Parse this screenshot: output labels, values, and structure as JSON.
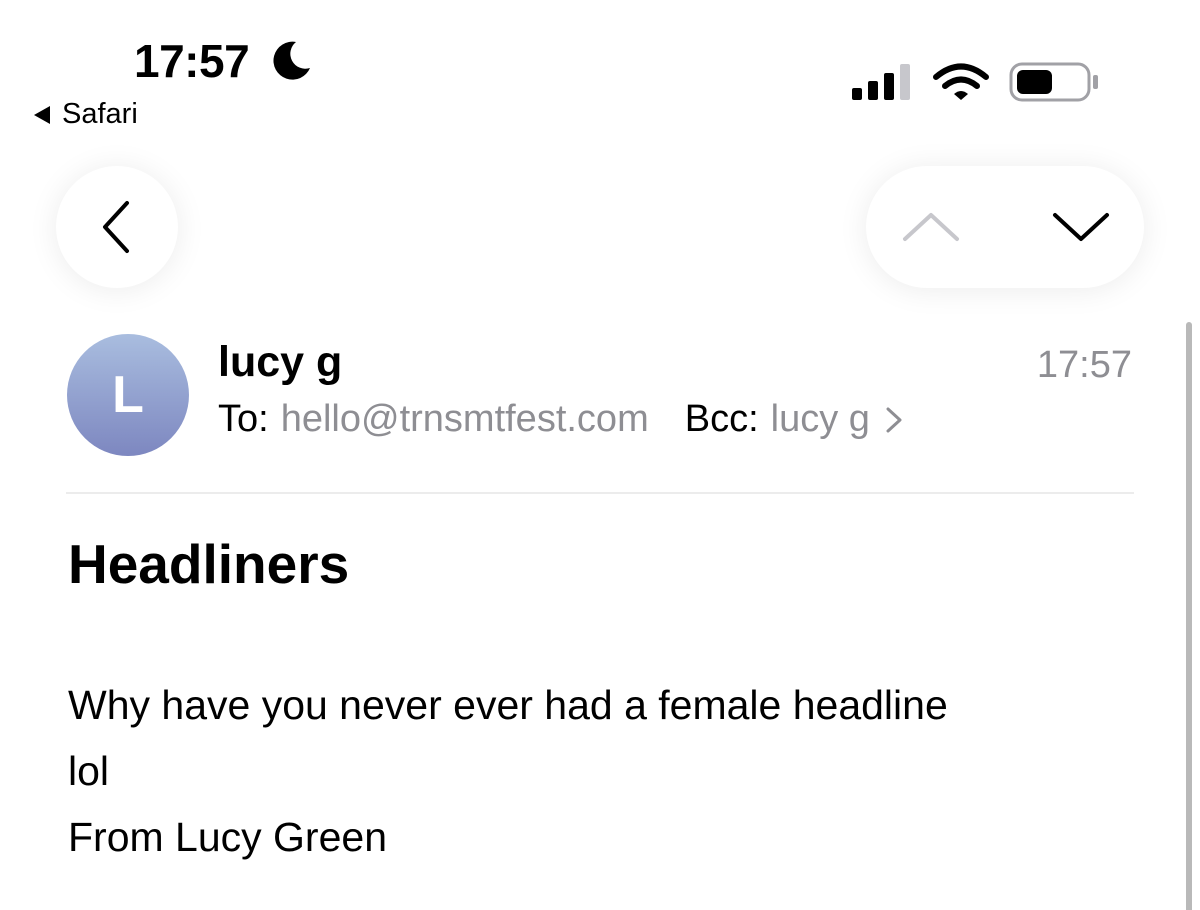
{
  "status_bar": {
    "time": "17:57",
    "back_app": "Safari",
    "icons": [
      "moon-icon",
      "signal-icon",
      "wifi-icon",
      "battery-icon"
    ]
  },
  "toolbar": {
    "back_icon": "chevron-left-icon",
    "prev_icon": "chevron-up-icon",
    "next_icon": "chevron-down-icon"
  },
  "email": {
    "avatar_letter": "L",
    "sender": "lucy g",
    "time": "17:57",
    "to_label": "To:",
    "to_value": "hello@trnsmtfest.com",
    "bcc_label": "Bcc:",
    "bcc_value": "lucy g",
    "subject": "Headliners",
    "body_lines": [
      "Why have you never ever had a female headline",
      "lol",
      "From Lucy Green"
    ]
  },
  "colors": {
    "secondary_text": "#8e8e93",
    "avatar_top": "#a9bddf",
    "avatar_bottom": "#7d87c0"
  }
}
